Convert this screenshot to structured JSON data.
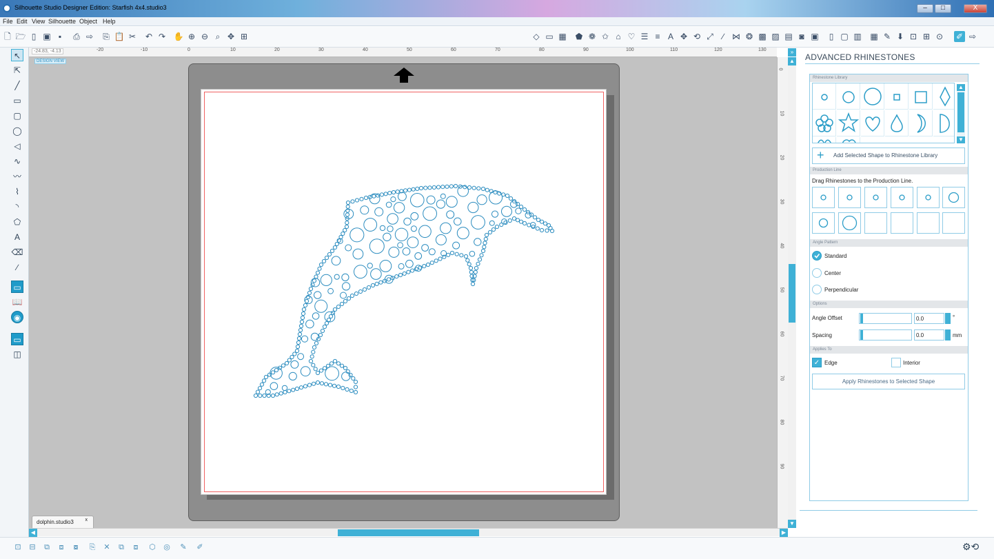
{
  "window": {
    "title": "Silhouette Studio Designer Edition: Starfish 4x4.studio3",
    "min": "–",
    "max": "□",
    "close": "X"
  },
  "menu": [
    "File",
    "Edit",
    "View",
    "Silhouette",
    "Object",
    "Help"
  ],
  "ruler": {
    "coords": "-24.83, -4.13",
    "top_ticks": [
      "-20",
      "-10",
      "0",
      "10",
      "20",
      "30",
      "40",
      "50",
      "60",
      "70",
      "80",
      "90",
      "100",
      "110",
      "120",
      "130"
    ],
    "right_ticks": [
      "0",
      "10",
      "20",
      "30",
      "40",
      "50",
      "60",
      "70",
      "80",
      "90"
    ]
  },
  "design_view_label": "DESIGN VIEW",
  "document_tab": {
    "name": "dolphin.studio3",
    "close": "x"
  },
  "panel": {
    "title": "ADVANCED RHINESTONES",
    "library_header": "Rhinestone Library",
    "add_shape_button": "Add Selected Shape to Rhinestone Library",
    "production_header": "Production Line",
    "drag_text": "Drag Rhinestones to the Production Line.",
    "angle_header": "Angle Pattern",
    "angle_options": [
      {
        "label": "Standard",
        "selected": true
      },
      {
        "label": "Center",
        "selected": false
      },
      {
        "label": "Perpendicular",
        "selected": false
      }
    ],
    "options_header": "Options",
    "angle_offset": {
      "label": "Angle Offset",
      "value": "0.0",
      "unit": "°"
    },
    "spacing": {
      "label": "Spacing",
      "value": "0.0",
      "unit": "mm"
    },
    "applies_header": "Applies To",
    "edge": {
      "label": "Edge",
      "checked": true
    },
    "interior": {
      "label": "Interior",
      "checked": false
    },
    "apply_button": "Apply Rhinestones to Selected Shape"
  },
  "colors": {
    "accent": "#3fb1d6",
    "rhinestone": "#2b8cbf",
    "cut_border": "#f06060"
  }
}
